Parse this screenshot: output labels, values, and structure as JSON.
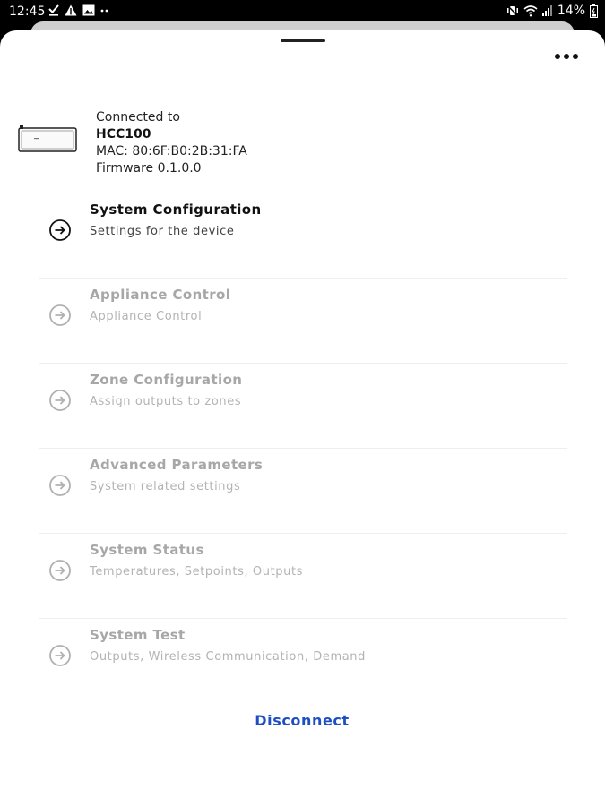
{
  "status_bar": {
    "time": "12:45",
    "battery": "14%",
    "left_icons": [
      "check-icon",
      "alert-triangle-icon",
      "image-icon",
      "more-dots-icon"
    ],
    "right_icons": [
      "mute-vibrate-icon",
      "wifi-icon",
      "signal-icon",
      "battery-icon"
    ]
  },
  "device": {
    "connected_label": "Connected to",
    "name": "HCC100",
    "mac": "MAC: 80:6F:B0:2B:31:FA",
    "firmware": "Firmware 0.1.0.0"
  },
  "menu": {
    "items": [
      {
        "title": "System Configuration",
        "subtitle": "Settings for the device",
        "enabled": true
      },
      {
        "title": "Appliance Control",
        "subtitle": "Appliance Control",
        "enabled": false
      },
      {
        "title": "Zone Configuration",
        "subtitle": "Assign outputs to zones",
        "enabled": false
      },
      {
        "title": "Advanced Parameters",
        "subtitle": "System related settings",
        "enabled": false
      },
      {
        "title": "System Status",
        "subtitle": "Temperatures, Setpoints, Outputs",
        "enabled": false
      },
      {
        "title": "System Test",
        "subtitle": "Outputs, Wireless Communication, Demand",
        "enabled": false
      }
    ]
  },
  "actions": {
    "disconnect_label": "Disconnect"
  },
  "colors": {
    "accent": "#1e4fc2",
    "enabled_text": "#111111",
    "disabled_text": "#a7a7a7"
  }
}
